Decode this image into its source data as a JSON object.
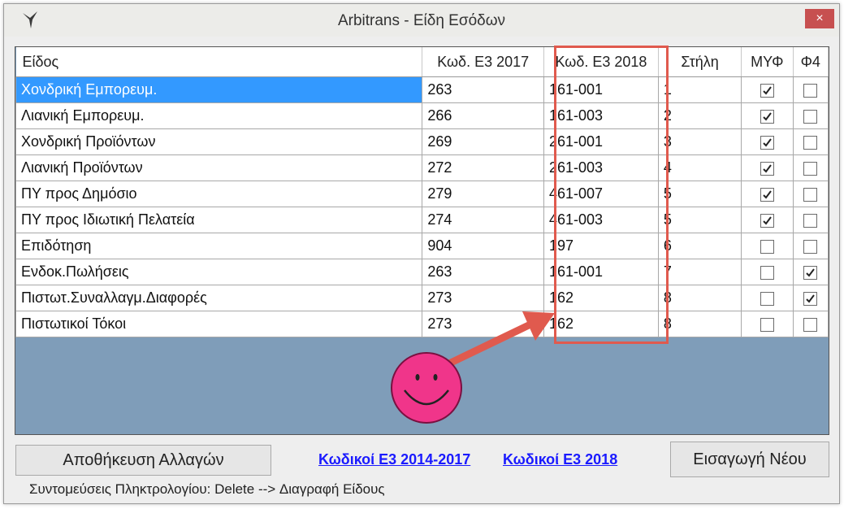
{
  "window": {
    "title": "Arbitrans - Είδη Εσόδων",
    "close_label": "×"
  },
  "table": {
    "headers": [
      "Είδος",
      "Κωδ. Ε3 2017",
      "Κωδ. Ε3 2018",
      "Στήλη",
      "ΜΥΦ",
      "Φ4"
    ],
    "rows": [
      {
        "name": "Χονδρική Εμπορευμ.",
        "e3_2017": "263",
        "e3_2018": "161-001",
        "stili": "1",
        "myf": true,
        "f4": false
      },
      {
        "name": "Λιανική Εμπορευμ.",
        "e3_2017": "266",
        "e3_2018": "161-003",
        "stili": "2",
        "myf": true,
        "f4": false
      },
      {
        "name": "Χονδρική Προϊόντων",
        "e3_2017": "269",
        "e3_2018": "261-001",
        "stili": "3",
        "myf": true,
        "f4": false
      },
      {
        "name": "Λιανική Προϊόντων",
        "e3_2017": "272",
        "e3_2018": "261-003",
        "stili": "4",
        "myf": true,
        "f4": false
      },
      {
        "name": "ΠΥ προς Δημόσιο",
        "e3_2017": "279",
        "e3_2018": "461-007",
        "stili": "5",
        "myf": true,
        "f4": false
      },
      {
        "name": "ΠΥ προς Ιδιωτική Πελατεία",
        "e3_2017": "274",
        "e3_2018": "461-003",
        "stili": "5",
        "myf": true,
        "f4": false
      },
      {
        "name": "Επιδότηση",
        "e3_2017": "904",
        "e3_2018": "197",
        "stili": "6",
        "myf": false,
        "f4": false
      },
      {
        "name": "Ενδοκ.Πωλήσεις",
        "e3_2017": "263",
        "e3_2018": "161-001",
        "stili": "7",
        "myf": false,
        "f4": true
      },
      {
        "name": "Πιστωτ.Συναλλαγμ.Διαφορές",
        "e3_2017": "273",
        "e3_2018": "162",
        "stili": "8",
        "myf": false,
        "f4": true
      },
      {
        "name": "Πιστωτικοί Τόκοι",
        "e3_2017": "273",
        "e3_2018": "162",
        "stili": "8",
        "myf": false,
        "f4": false
      }
    ]
  },
  "buttons": {
    "save": "Αποθήκευση Αλλαγών",
    "new": "Εισαγωγή Νέου"
  },
  "links": {
    "codes_2014_2017": "Κωδικοί Ε3 2014-2017",
    "codes_2018": "Κωδικοί Ε3 2018"
  },
  "status": "Συντομεύσεις Πληκτρολογίου: Delete --> Διαγραφή Είδους",
  "colors": {
    "selection": "#3399ff",
    "highlight": "#e05a4e",
    "grid_bg": "#7f9db9",
    "smiley": "#f0358a"
  }
}
